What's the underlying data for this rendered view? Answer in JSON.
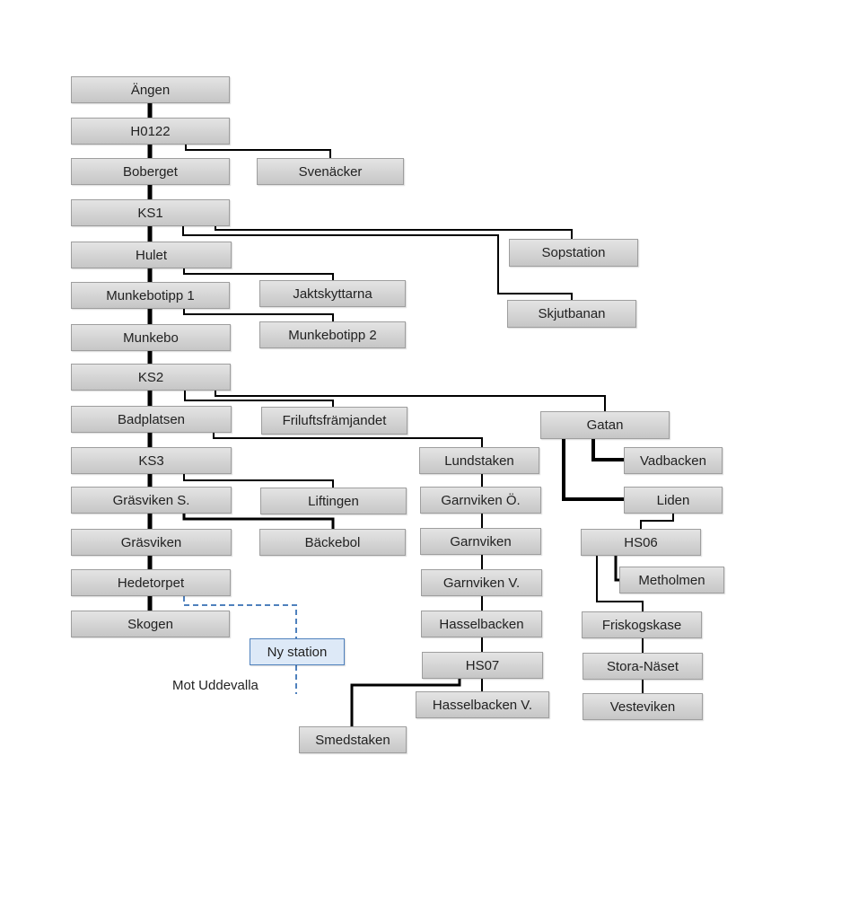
{
  "diagram": {
    "nodes": [
      {
        "id": "angen",
        "label": "Ängen"
      },
      {
        "id": "h0122",
        "label": "H0122"
      },
      {
        "id": "boberget",
        "label": "Boberget"
      },
      {
        "id": "svenacker",
        "label": "Svenäcker"
      },
      {
        "id": "ks1",
        "label": "KS1"
      },
      {
        "id": "hulet",
        "label": "Hulet"
      },
      {
        "id": "sopstation",
        "label": "Sopstation"
      },
      {
        "id": "jaktskyttarna",
        "label": "Jaktskyttarna"
      },
      {
        "id": "munkebotipp1",
        "label": "Munkebotipp 1"
      },
      {
        "id": "skjutbanan",
        "label": "Skjutbanan"
      },
      {
        "id": "munkebo",
        "label": "Munkebo"
      },
      {
        "id": "munkebotipp2",
        "label": "Munkebotipp 2"
      },
      {
        "id": "ks2",
        "label": "KS2"
      },
      {
        "id": "badplatsen",
        "label": "Badplatsen"
      },
      {
        "id": "friluftsframjandet",
        "label": "Friluftsfrämjandet"
      },
      {
        "id": "gatan",
        "label": "Gatan"
      },
      {
        "id": "ks3",
        "label": "KS3"
      },
      {
        "id": "lundstaken",
        "label": "Lundstaken"
      },
      {
        "id": "vadbacken",
        "label": "Vadbacken"
      },
      {
        "id": "grasvikens",
        "label": "Gräsviken S."
      },
      {
        "id": "liftingen",
        "label": "Liftingen"
      },
      {
        "id": "garnvikeno",
        "label": "Garnviken Ö."
      },
      {
        "id": "liden",
        "label": "Liden"
      },
      {
        "id": "grasviken",
        "label": "Gräsviken"
      },
      {
        "id": "backebol",
        "label": "Bäckebol"
      },
      {
        "id": "garnviken",
        "label": "Garnviken"
      },
      {
        "id": "hs06",
        "label": "HS06"
      },
      {
        "id": "metholmen",
        "label": "Metholmen"
      },
      {
        "id": "hedetorpet",
        "label": "Hedetorpet"
      },
      {
        "id": "garnvikenv",
        "label": "Garnviken V."
      },
      {
        "id": "skogen",
        "label": "Skogen"
      },
      {
        "id": "hasselbacken",
        "label": "Hasselbacken"
      },
      {
        "id": "friskogskase",
        "label": "Friskogskase"
      },
      {
        "id": "nystation",
        "label": "Ny station",
        "planned": true
      },
      {
        "id": "hs07",
        "label": "HS07"
      },
      {
        "id": "storanaset",
        "label": "Stora-Näset"
      },
      {
        "id": "hasselbackenv",
        "label": "Hasselbacken V."
      },
      {
        "id": "vesteviken",
        "label": "Vesteviken"
      },
      {
        "id": "smedstaken",
        "label": "Smedstaken"
      }
    ],
    "annotation": "Mot Uddevalla",
    "colors": {
      "node_fill": "#d4d4d4",
      "node_border": "#9e9e9e",
      "line": "#000000",
      "planned": "#4f81bd",
      "planned_fill": "#dde9f7"
    }
  }
}
